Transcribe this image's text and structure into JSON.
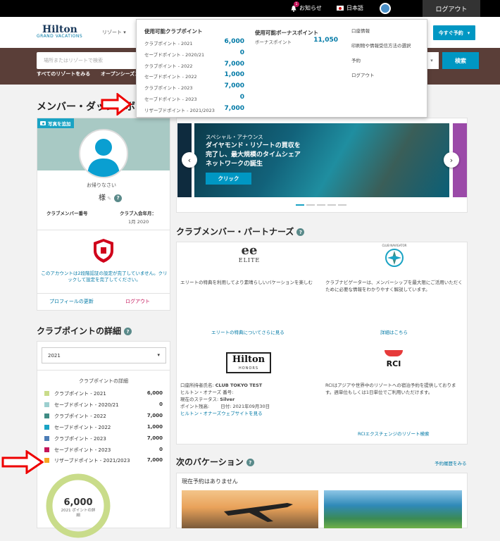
{
  "topbar": {
    "notifications_label": "お知らせ",
    "notification_count": "1",
    "language_label": "日本語",
    "logout_label": "ログアウト"
  },
  "header": {
    "logo_title": "Hilton",
    "logo_subtitle": "GRAND VACATIONS",
    "resorts_menu": "リゾート",
    "book_now": "今すぐ予約"
  },
  "banner": {
    "search_placeholder": "場所またはリゾートで検索",
    "search_button": "検索",
    "link_all_resorts": "すべてのリゾートをみる",
    "link_open_season": "オープンシーズン"
  },
  "dropdown": {
    "club_header": "使用可能クラブポイント",
    "club_rows": [
      {
        "label": "クラブポイント - 2021",
        "value": "6,000"
      },
      {
        "label": "セーブドポイント - 2020/21",
        "value": "0"
      },
      {
        "label": "クラブポイント - 2022",
        "value": "7,000"
      },
      {
        "label": "セーブドポイント - 2022",
        "value": "1,000"
      },
      {
        "label": "クラブポイント - 2023",
        "value": "7,000"
      },
      {
        "label": "セーブドポイント - 2023",
        "value": "0"
      },
      {
        "label": "リザーブドポイント - 2021/2023",
        "value": "7,000"
      }
    ],
    "bonus_header": "使用可能ボーナスポイント",
    "bonus_label": "ボーナスポイント",
    "bonus_value": "11,050",
    "links": [
      "口座情報",
      "印刷物や情報受信方法の選択",
      "予約",
      "ログアウト"
    ]
  },
  "page_title": "メンバー・ダッシュボード",
  "profile": {
    "add_photo": "写真を追加",
    "welcome": "お帰りなさい",
    "name_suffix": "様",
    "member_no_label": "クラブメンバー番号",
    "join_label": "クラブ入会年月：",
    "join_value": "1月 2020",
    "security_notice": "このアカウントは2段階認証の設定が完了していません。クリックして設定を完了してください。",
    "update_profile": "プロフィールの更新",
    "logout": "ログアウト"
  },
  "carousel": {
    "kicker": "スペシャル・アナウンス",
    "headline": "ダイヤモンド・リゾートの買収を完了し、最大規模のタイムシェアネットワークの誕生",
    "cta": "クリック"
  },
  "partners": {
    "title": "クラブメンバー・パートナーズ",
    "elite_logo": "ELITE",
    "elite_desc": "エリートの特典を利用してより素晴らしいバケーションを楽しむ",
    "elite_link": "エリートの特典についてさらに見る",
    "navigator_logo": "CLUB NAVIGATOR",
    "navigator_desc": "クラブナビゲーターは、メンバーシップを最大限にご活用いただくために必要な情報をわかりやすく解説しています。",
    "navigator_link": "詳細はこちら",
    "hilton_logo": "Hilton",
    "hilton_sub": "HONORS",
    "hilton_holder_label": "口座所持者氏名:",
    "hilton_holder": "CLUB TOKYO TEST",
    "hilton_number": "ヒルトン・オナーズ 番号:",
    "hilton_status_label": "現在のステータス:",
    "hilton_status": "Silver",
    "hilton_balance_label": "ポイント残高:",
    "hilton_balance_date": "日付: 2021年09月30日",
    "hilton_link": "ヒルトン・オナーズウェブサイトを見る",
    "rci_logo": "RCI",
    "rci_desc": "RCIはアジアや世界中のリゾートへの宿泊予約を提供しております。週単位もしくは1日単位でご利用いただけます。",
    "rci_link": "RCIエクスチェンジのリゾート検索"
  },
  "points_detail": {
    "title": "クラブポイントの詳細",
    "year_select": "2021",
    "subtitle": "クラブポイントの詳細",
    "rows": [
      {
        "label": "クラブポイント - 2021",
        "value": "6,000",
        "color": "#c9dc8a"
      },
      {
        "label": "セーブドポイント - 2020/21",
        "value": "0",
        "color": "#9ccfcf"
      },
      {
        "label": "クラブポイント - 2022",
        "value": "7,000",
        "color": "#3f8c84"
      },
      {
        "label": "セーブドポイント - 2022",
        "value": "1,000",
        "color": "#1aa3c4"
      },
      {
        "label": "クラブポイント - 2023",
        "value": "7,000",
        "color": "#4d7db6"
      },
      {
        "label": "セーブドポイント - 2023",
        "value": "0",
        "color": "#c4155a"
      },
      {
        "label": "リザーブドポイント - 2021/2023",
        "value": "7,000",
        "color": "#f5a623"
      }
    ],
    "donut_value": "6,000",
    "donut_caption": "2021 ポイントの詳細"
  },
  "next_vacation": {
    "title": "次のバケーション",
    "history_link": "予約履歴をみる",
    "empty_text": "現在予約はありません"
  }
}
